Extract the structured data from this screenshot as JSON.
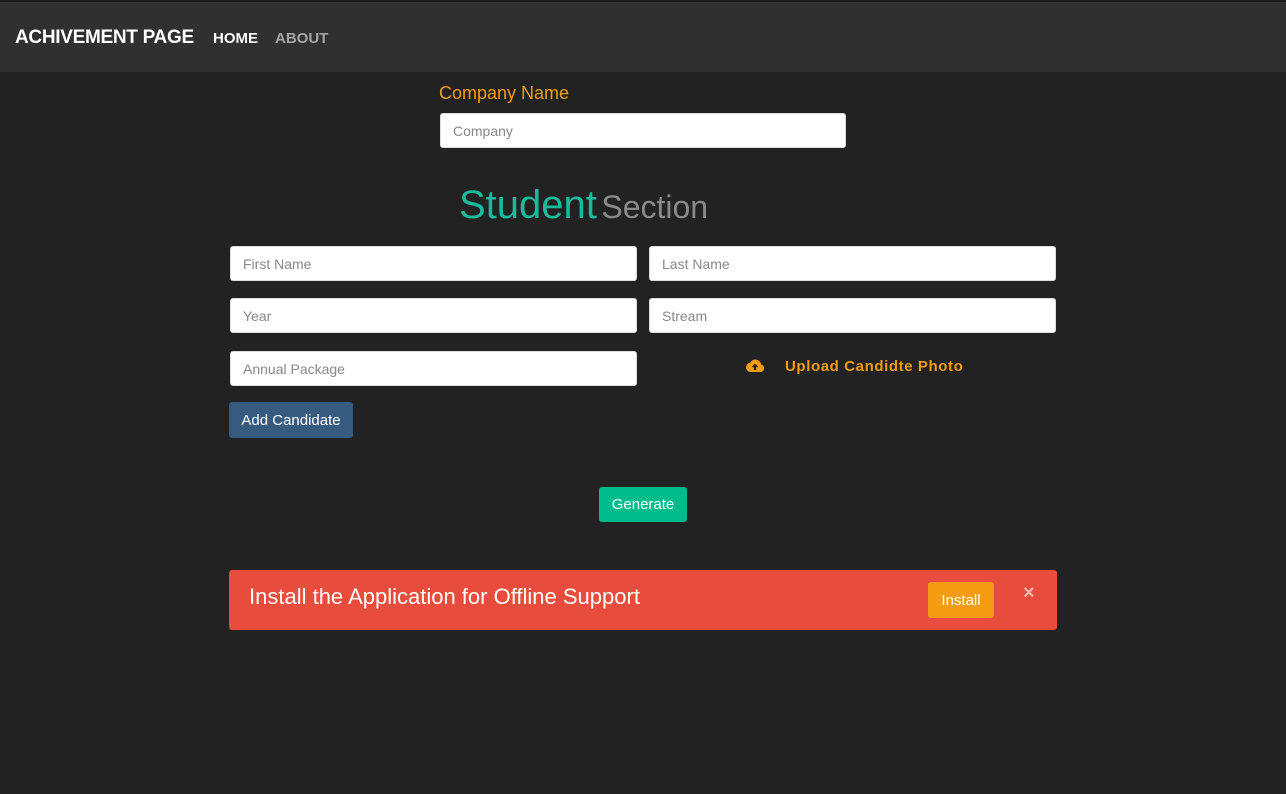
{
  "navbar": {
    "brand": "ACHIVEMENT PAGE",
    "links": [
      {
        "label": "HOME",
        "active": true
      },
      {
        "label": "ABOUT",
        "active": false
      }
    ]
  },
  "company": {
    "label": "Company Name",
    "placeholder": "Company",
    "value": ""
  },
  "section": {
    "title_primary": "Student",
    "title_secondary": "Section"
  },
  "form": {
    "first_name": {
      "placeholder": "First Name",
      "value": ""
    },
    "last_name": {
      "placeholder": "Last Name",
      "value": ""
    },
    "year": {
      "placeholder": "Year",
      "value": ""
    },
    "stream": {
      "placeholder": "Stream",
      "value": ""
    },
    "annual_package": {
      "placeholder": "Annual Package",
      "value": ""
    },
    "upload_label": "Upload Candidte Photo",
    "upload_icon": "cloud-upload-icon",
    "add_button": "Add Candidate"
  },
  "generate_button": "Generate",
  "install_alert": {
    "message": "Install the Application for Offline Support",
    "install_button": "Install",
    "close_symbol": "×"
  },
  "colors": {
    "background": "#222222",
    "navbar": "#303030",
    "accent_orange": "#f39c12",
    "accent_green": "#18bc9c",
    "primary_blue": "#375a7f",
    "danger_red": "#e74c3c"
  }
}
